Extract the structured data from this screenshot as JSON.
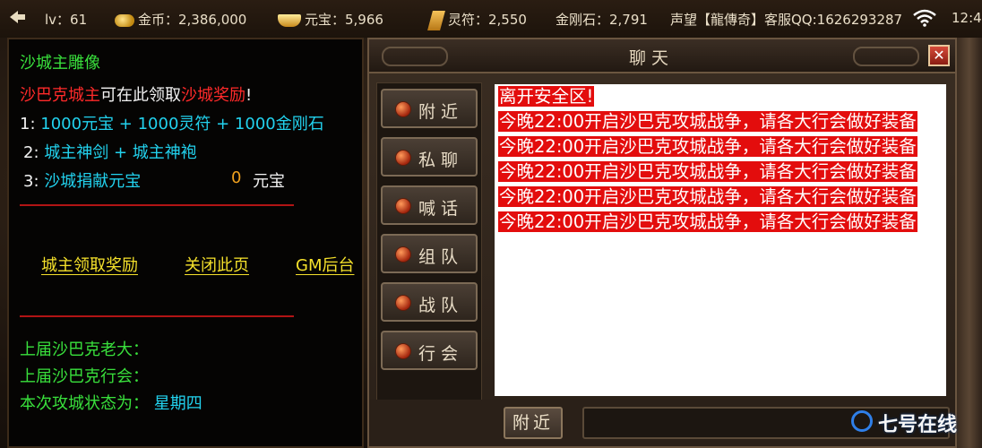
{
  "topbar": {
    "level": "lv：61",
    "gold": "金币：2,386,000",
    "yuanbao": "元宝：5,966",
    "lingfu": "灵符：2,550",
    "jingangshi": "金刚石：2,791",
    "server_info": "声望【龍傳奇】客服QQ:1626293287",
    "clock": "12:4"
  },
  "left_panel": {
    "title": "沙城主雕像",
    "intro_highlight_1": "沙巴克城主",
    "intro_text": "可在此领取",
    "intro_highlight_2": "沙城奖励",
    "intro_end": "!",
    "reward_1_num": "1:",
    "reward_1_text": "1000元宝 + 1000灵符 + 1000金刚石",
    "reward_2_num": "2:",
    "reward_2_text": "城主神剑 + 城主神袍",
    "reward_3_num": "3:",
    "reward_3_text": "沙城捐献元宝",
    "reward_3_value": "0",
    "reward_3_unit": "元宝",
    "link_claim": "城主领取奖励",
    "link_close": "关闭此页",
    "link_gm": "GM后台",
    "last_boss_label": "上届沙巴克老大：",
    "last_guild_label": "上届沙巴克行会：",
    "siege_status_label": "本次攻城状态为：",
    "siege_status_value": "星期四"
  },
  "chat": {
    "title": "聊天",
    "close_label": "✕",
    "tabs": [
      "附近",
      "私聊",
      "喊话",
      "组队",
      "战队",
      "行会"
    ],
    "messages": [
      "离开安全区!",
      "今晚22:00开启沙巴克攻城战争，请各大行会做好装备",
      "今晚22:00开启沙巴克攻城战争，请各大行会做好装备",
      "今晚22:00开启沙巴克攻城战争，请各大行会做好装备",
      "今晚22:00开启沙巴克攻城战争，请各大行会做好装备",
      "今晚22:00开启沙巴克攻城战争，请各大行会做好装备"
    ],
    "channel_button": "附近",
    "input_value": ""
  },
  "watermark": "七号在线"
}
